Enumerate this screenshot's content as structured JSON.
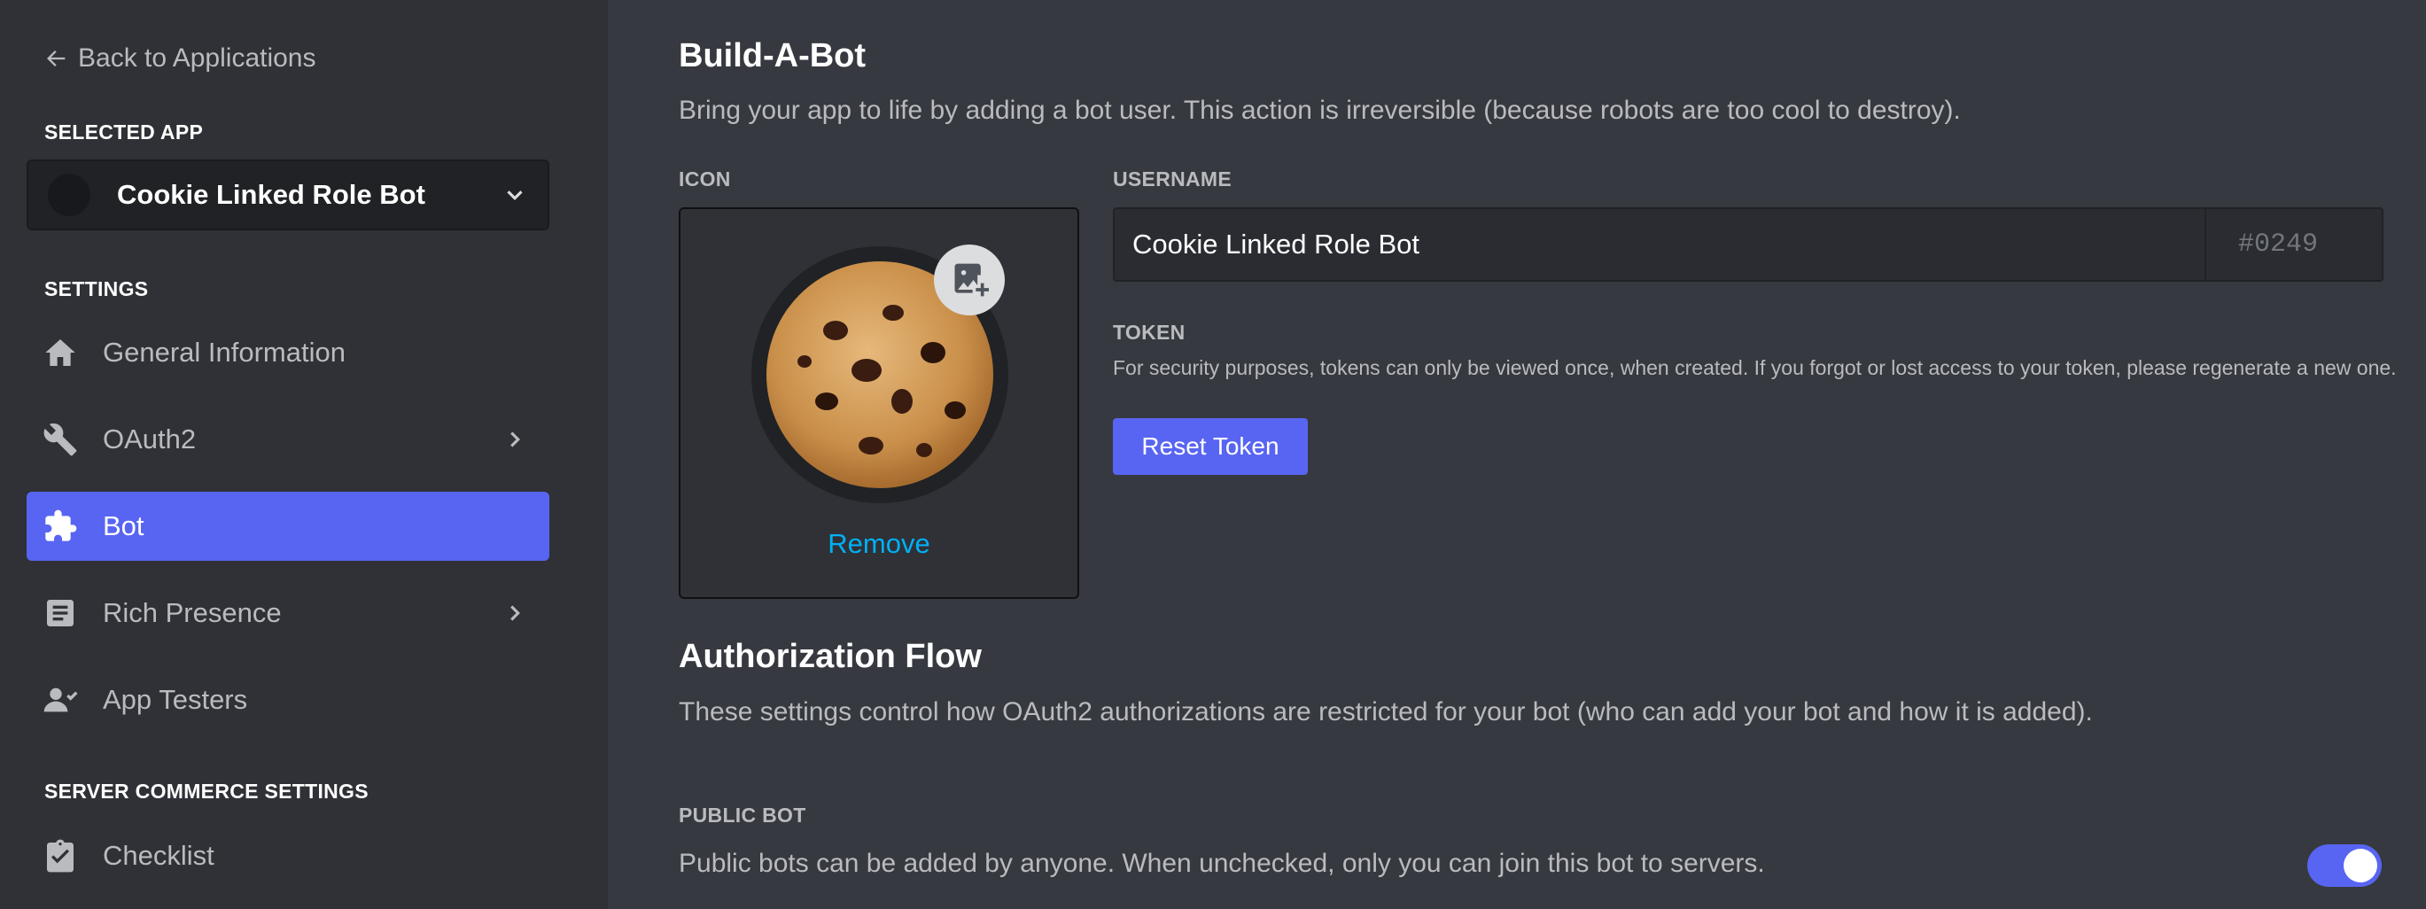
{
  "sidebar": {
    "back_label": "Back to Applications",
    "selected_app_heading": "SELECTED APP",
    "selected_app_name": "Cookie Linked Role Bot",
    "settings_heading": "SETTINGS",
    "items": [
      {
        "label": "General Information",
        "icon": "home-icon"
      },
      {
        "label": "OAuth2",
        "icon": "wrench-icon"
      },
      {
        "label": "Bot",
        "icon": "puzzle-icon"
      },
      {
        "label": "Rich Presence",
        "icon": "document-icon"
      },
      {
        "label": "App Testers",
        "icon": "person-icon"
      }
    ],
    "commerce_heading": "SERVER COMMERCE SETTINGS",
    "commerce_items": [
      {
        "label": "Checklist",
        "icon": "clipboard-check-icon"
      }
    ]
  },
  "main": {
    "build_title": "Build-A-Bot",
    "build_desc": "Bring your app to life by adding a bot user. This action is irreversible (because robots are too cool to destroy).",
    "icon_label": "ICON",
    "remove_label": "Remove",
    "username_label": "USERNAME",
    "username_value": "Cookie Linked Role Bot",
    "discriminator": "#0249",
    "token_label": "TOKEN",
    "token_desc": "For security purposes, tokens can only be viewed once, when created. If you forgot or lost access to your token, please regenerate a new one.",
    "reset_token_label": "Reset Token",
    "auth_title": "Authorization Flow",
    "auth_desc": "These settings control how OAuth2 authorizations are restricted for your bot (who can add your bot and how it is added).",
    "public_bot_label": "PUBLIC BOT",
    "public_bot_desc": "Public bots can be added by anyone. When unchecked, only you can join this bot to servers.",
    "public_bot_enabled": true
  },
  "colors": {
    "accent": "#5865f2",
    "link": "#00b0f4",
    "sidebar_bg": "#2f3136",
    "main_bg": "#36393f"
  }
}
